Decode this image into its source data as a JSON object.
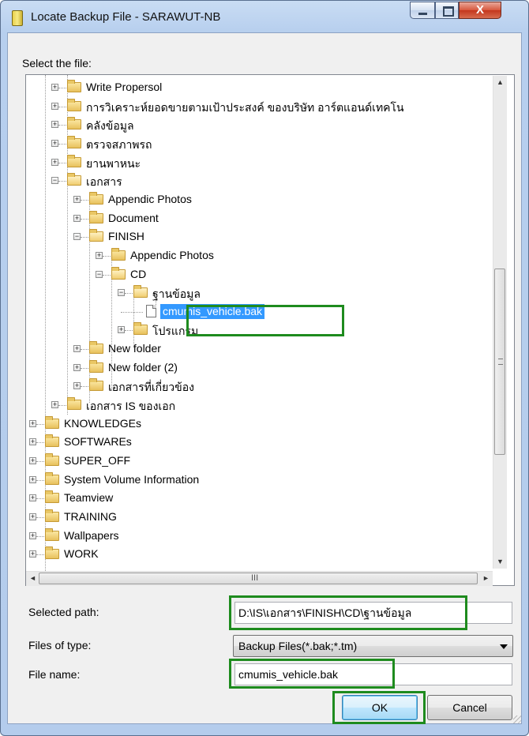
{
  "window": {
    "title": "Locate Backup File - SARAWUT-NB"
  },
  "select_label": "Select the file:",
  "tree": [
    {
      "label": "Write Propersol",
      "expander": "+",
      "kind": "folder"
    },
    {
      "label": "การวิเคราะห์ยอดขายตามเป้าประสงค์ ของบริษัท อาร์ตแอนด์เทคโน",
      "expander": "+",
      "kind": "folder"
    },
    {
      "label": "คลังข้อมูล",
      "expander": "+",
      "kind": "folder"
    },
    {
      "label": "ตรวจสภาพรถ",
      "expander": "+",
      "kind": "folder"
    },
    {
      "label": "ยานพาหนะ",
      "expander": "+",
      "kind": "folder"
    },
    {
      "label": "เอกสาร",
      "expander": "−",
      "kind": "folder-open"
    },
    {
      "label": "Appendic Photos",
      "expander": "+",
      "kind": "folder"
    },
    {
      "label": "Document",
      "expander": "+",
      "kind": "folder"
    },
    {
      "label": "FINISH",
      "expander": "−",
      "kind": "folder-open"
    },
    {
      "label": "Appendic Photos",
      "expander": "+",
      "kind": "folder"
    },
    {
      "label": "CD",
      "expander": "−",
      "kind": "folder-open"
    },
    {
      "label": "ฐานข้อมูล",
      "expander": "−",
      "kind": "folder-open"
    },
    {
      "label": "cmumis_vehicle.bak",
      "expander": "",
      "kind": "file",
      "selected": true
    },
    {
      "label": "โปรแกรม",
      "expander": "+",
      "kind": "folder"
    },
    {
      "label": "New folder",
      "expander": "+",
      "kind": "folder"
    },
    {
      "label": "New folder (2)",
      "expander": "+",
      "kind": "folder"
    },
    {
      "label": "เอกสารที่เกี่ยวข้อง",
      "expander": "+",
      "kind": "folder"
    },
    {
      "label": "เอกสาร IS ของเอก",
      "expander": "+",
      "kind": "folder"
    },
    {
      "label": "KNOWLEDGEs",
      "expander": "+",
      "kind": "folder"
    },
    {
      "label": "SOFTWAREs",
      "expander": "+",
      "kind": "folder"
    },
    {
      "label": "SUPER_OFF",
      "expander": "+",
      "kind": "folder"
    },
    {
      "label": "System Volume Information",
      "expander": "+",
      "kind": "folder"
    },
    {
      "label": "Teamview",
      "expander": "+",
      "kind": "folder"
    },
    {
      "label": "TRAINING",
      "expander": "+",
      "kind": "folder"
    },
    {
      "label": "Wallpapers",
      "expander": "+",
      "kind": "folder"
    },
    {
      "label": "WORK",
      "expander": "+",
      "kind": "folder"
    }
  ],
  "scrollbar": {
    "up": "▲",
    "down": "▼",
    "left": "◄",
    "right": "►",
    "grip": "III"
  },
  "selected_path": {
    "label": "Selected path:",
    "value": "D:\\IS\\เอกสาร\\FINISH\\CD\\ฐานข้อมูล"
  },
  "files_of_type": {
    "label": "Files of type:",
    "value": "Backup Files(*.bak;*.tm)"
  },
  "file_name": {
    "label": "File name:",
    "value": "cmumis_vehicle.bak"
  },
  "buttons": {
    "ok": "OK",
    "cancel": "Cancel"
  },
  "window_buttons": {
    "minimize": "",
    "maximize": "",
    "close": "X"
  },
  "colors": {
    "highlight": "#1e8b1e",
    "selection": "#3399ff"
  }
}
